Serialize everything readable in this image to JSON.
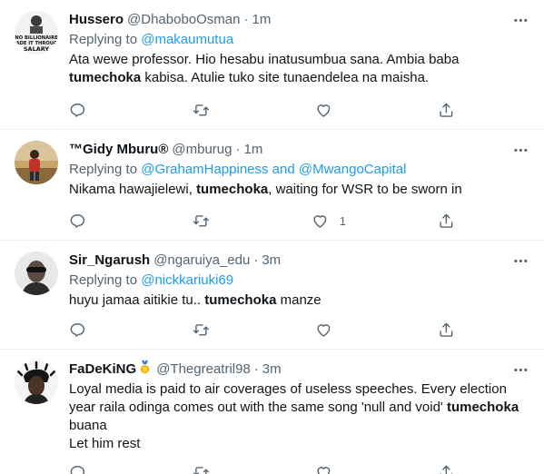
{
  "replying_label": "Replying to",
  "tweets": [
    {
      "name": "Hussero",
      "handle": "@DhaboboOsman",
      "separator": "·",
      "time": "1m",
      "mentions": "@makaumutua",
      "text_parts": [
        "Ata wewe professor. Hio hesabu inatusumbua sana. Ambia baba ",
        "tumechoka",
        " kabisa. Atulie tuko site tunaendelea na maisha."
      ],
      "avatar_text": "NO BILLIONAIRE MADE IT THROUGH SALARY",
      "likes": ""
    },
    {
      "name": "™Gidy Mburu®",
      "handle": "@mburug",
      "separator": "·",
      "time": "1m",
      "mentions": "@GrahamHappiness and @MwangoCapital",
      "text_parts": [
        "Nikama hawajielewi, ",
        "tumechoka",
        ", waiting for WSR to be sworn in"
      ],
      "likes": "1"
    },
    {
      "name": "Sir_Ngarush",
      "handle": "@ngaruiya_edu",
      "separator": "·",
      "time": "3m",
      "mentions": "@nickkariuki69",
      "text_parts": [
        "huyu jamaa aitikie tu.. ",
        "tumechoka",
        " manze"
      ],
      "likes": ""
    },
    {
      "name": "FaDeKiNG",
      "handle": "@Thegreatril98",
      "separator": "·",
      "time": "3m",
      "text_parts": [
        "Loyal media is paid to air coverages of useless speeches. Every election year raila odinga comes out with the same song 'null and void' ",
        "tumechoka",
        " buana"
      ],
      "text_line2": "Let him rest",
      "likes": ""
    }
  ],
  "colors": {
    "text": "#0f1419",
    "secondary": "#536471",
    "link": "#1d9bf0",
    "divider": "#eff3f4"
  },
  "icons": [
    "reply-icon",
    "retweet-icon",
    "like-icon",
    "share-icon",
    "more-icon",
    "medal-icon"
  ]
}
